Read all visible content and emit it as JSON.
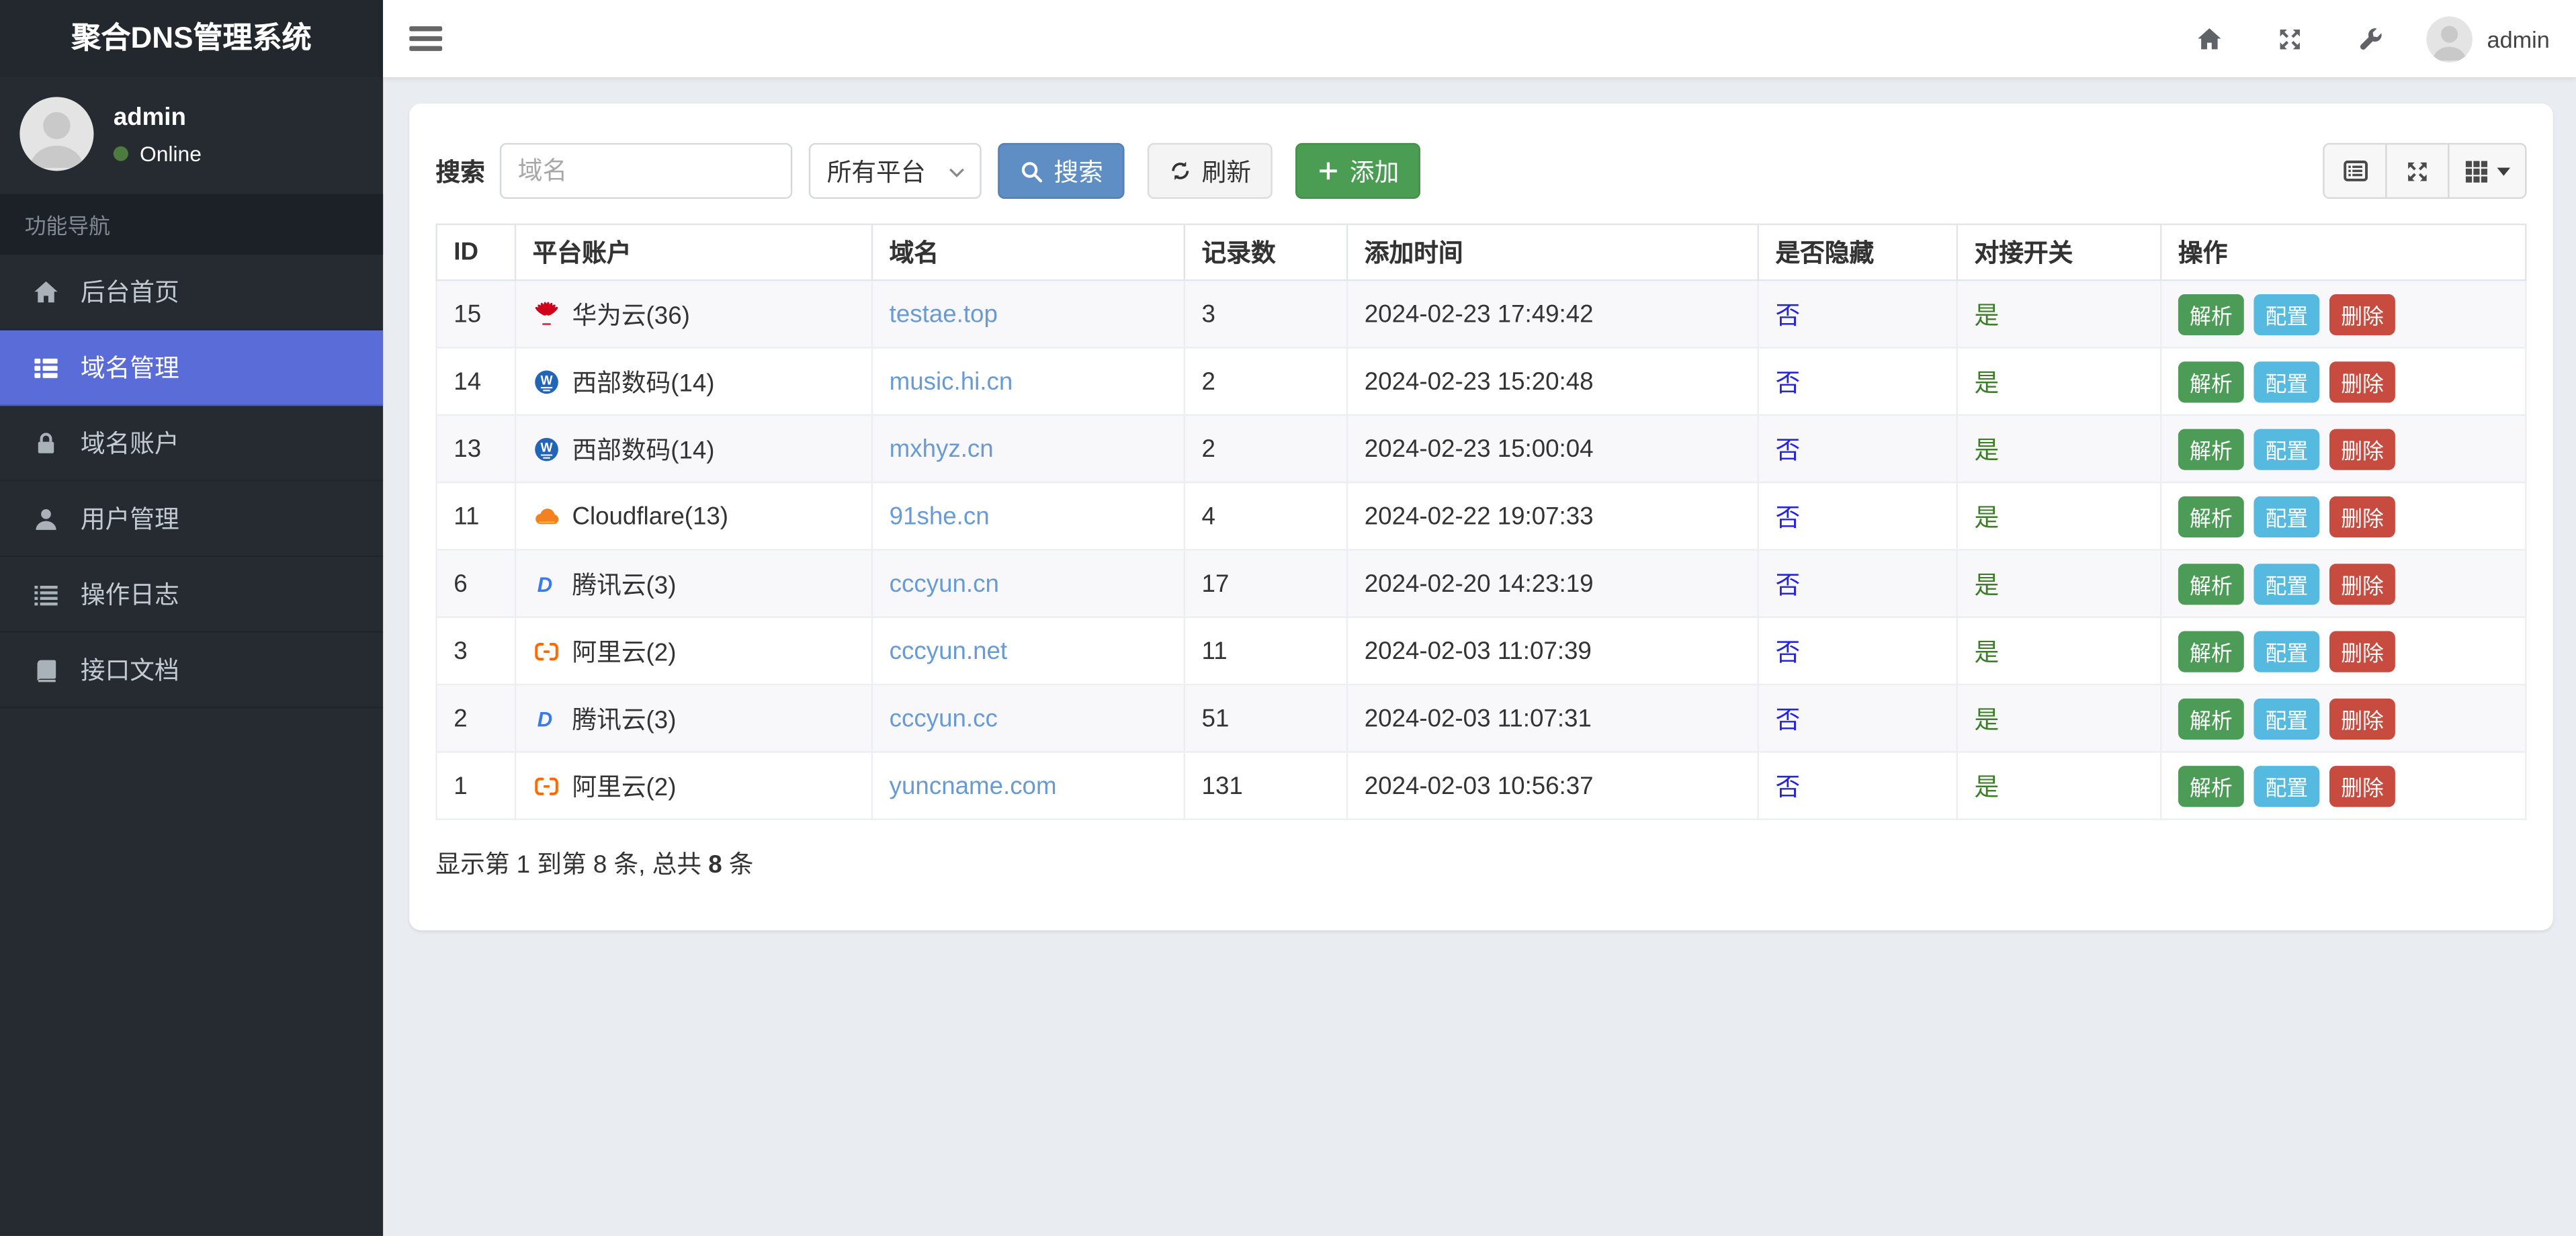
{
  "app": {
    "title": "聚合DNS管理系统"
  },
  "topbar": {
    "username": "admin",
    "icons": [
      "home-icon",
      "fullscreen-icon",
      "wrench-icon"
    ]
  },
  "sidebar": {
    "user": {
      "name": "admin",
      "status": "Online"
    },
    "nav_header": "功能导航",
    "items": [
      {
        "label": "后台首页",
        "icon": "home-icon",
        "active": false
      },
      {
        "label": "域名管理",
        "icon": "th-list-icon",
        "active": true
      },
      {
        "label": "域名账户",
        "icon": "lock-icon",
        "active": false
      },
      {
        "label": "用户管理",
        "icon": "user-icon",
        "active": false
      },
      {
        "label": "操作日志",
        "icon": "list-icon",
        "active": false
      },
      {
        "label": "接口文档",
        "icon": "book-icon",
        "active": false
      }
    ]
  },
  "toolbar": {
    "search_label": "搜索",
    "search_placeholder": "域名",
    "platform_select_value": "所有平台",
    "search_button": "搜索",
    "refresh_button": "刷新",
    "add_button": "添加",
    "view_buttons": [
      "list-view-icon",
      "fullscreen-icon",
      "columns-grid-icon"
    ]
  },
  "table": {
    "columns": [
      "ID",
      "平台账户",
      "域名",
      "记录数",
      "添加时间",
      "是否隐藏",
      "对接开关",
      "操作"
    ],
    "actions": [
      "解析",
      "配置",
      "删除"
    ],
    "rows": [
      {
        "id": "15",
        "platform": "华为云(36)",
        "platform_icon": "huawei",
        "domain": "testae.top",
        "records": "3",
        "added": "2024-02-23 17:49:42",
        "hidden": "否",
        "switch": "是"
      },
      {
        "id": "14",
        "platform": "西部数码(14)",
        "platform_icon": "west",
        "domain": "music.hi.cn",
        "records": "2",
        "added": "2024-02-23 15:20:48",
        "hidden": "否",
        "switch": "是"
      },
      {
        "id": "13",
        "platform": "西部数码(14)",
        "platform_icon": "west",
        "domain": "mxhyz.cn",
        "records": "2",
        "added": "2024-02-23 15:00:04",
        "hidden": "否",
        "switch": "是"
      },
      {
        "id": "11",
        "platform": "Cloudflare(13)",
        "platform_icon": "cloudflare",
        "domain": "91she.cn",
        "records": "4",
        "added": "2024-02-22 19:07:33",
        "hidden": "否",
        "switch": "是"
      },
      {
        "id": "6",
        "platform": "腾讯云(3)",
        "platform_icon": "dnspod",
        "domain": "cccyun.cn",
        "records": "17",
        "added": "2024-02-20 14:23:19",
        "hidden": "否",
        "switch": "是"
      },
      {
        "id": "3",
        "platform": "阿里云(2)",
        "platform_icon": "aliyun",
        "domain": "cccyun.net",
        "records": "11",
        "added": "2024-02-03 11:07:39",
        "hidden": "否",
        "switch": "是"
      },
      {
        "id": "2",
        "platform": "腾讯云(3)",
        "platform_icon": "dnspod",
        "domain": "cccyun.cc",
        "records": "51",
        "added": "2024-02-03 11:07:31",
        "hidden": "否",
        "switch": "是"
      },
      {
        "id": "1",
        "platform": "阿里云(2)",
        "platform_icon": "aliyun",
        "domain": "yuncname.com",
        "records": "131",
        "added": "2024-02-03 10:56:37",
        "hidden": "否",
        "switch": "是"
      }
    ],
    "summary_prefix": "显示第 1 到第 8 条, 总共 ",
    "summary_total": "8",
    "summary_suffix": " 条"
  },
  "colors": {
    "sidebar_bg": "#252b31",
    "active_nav": "#5a6cd8",
    "page_bg": "#e9ecf1",
    "search_button": "#5f8ec4",
    "add_button": "#4a9d52",
    "parse_badge": "#4c9b56",
    "config_badge": "#56b9e0",
    "delete_badge": "#c74b3e",
    "domain_link": "#689bd3",
    "hidden_no_text": "#2525e0",
    "switch_yes_text": "#3d7d2a",
    "online_dot": "#4c7a3f"
  }
}
